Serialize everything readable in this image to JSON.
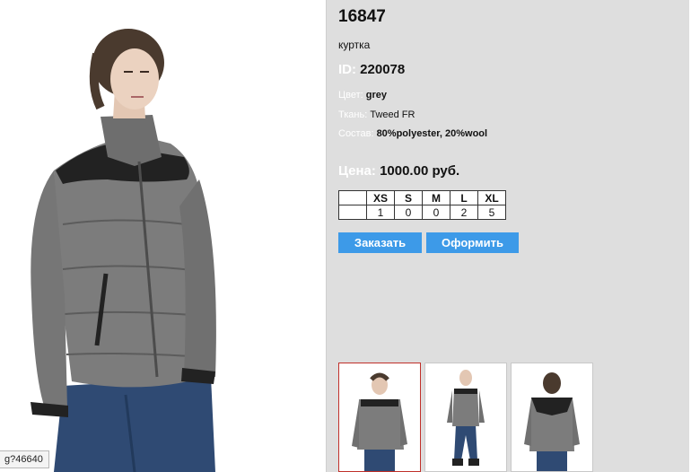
{
  "product": {
    "number": "16847",
    "type": "куртка",
    "id_label": "ID:",
    "id_value": "220078",
    "color_label": "Цвет:",
    "color_value": "grey",
    "fabric_label": "Ткань:",
    "fabric_value": "Tweed FR",
    "composition_label": "Состав:",
    "composition_value": "80%polyester, 20%wool",
    "price_label": "Цена:",
    "price_value": "1000.00 руб."
  },
  "sizes": {
    "headers": [
      "XS",
      "S",
      "M",
      "L",
      "XL"
    ],
    "quantities": [
      "1",
      "0",
      "0",
      "2",
      "5"
    ]
  },
  "buttons": {
    "order": "Заказать",
    "checkout": "Оформить"
  },
  "status_tip": "g?46640",
  "colors": {
    "panel_bg": "#dedede",
    "button_bg": "#3d9ae8",
    "selected_thumb_border": "#c0302a",
    "jacket_grey": "#7c7c7c",
    "yoke_black": "#222222",
    "jeans_blue": "#2f4a73"
  }
}
